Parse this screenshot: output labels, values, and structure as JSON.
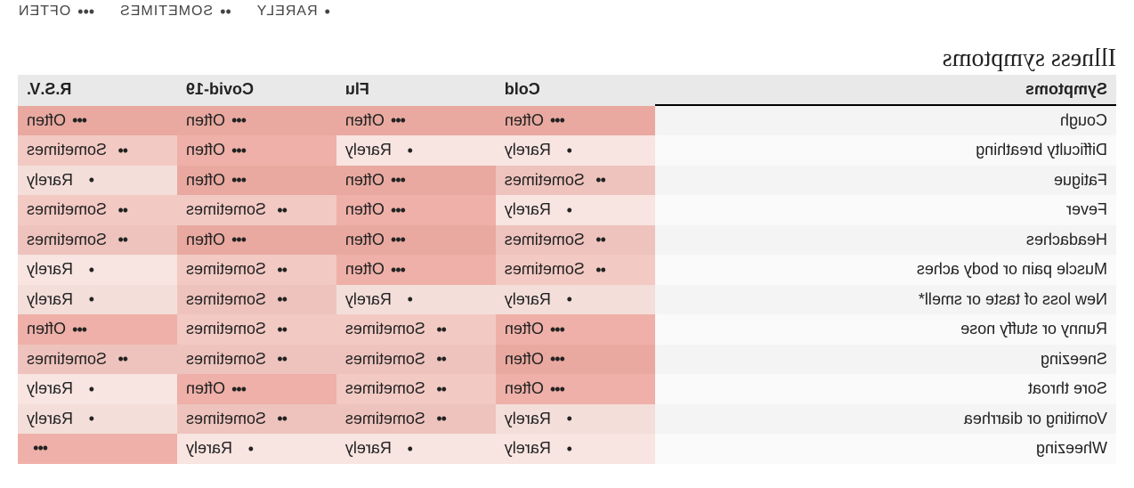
{
  "legend": {
    "rarely": {
      "dots": "•",
      "label": "RARELY"
    },
    "sometimes": {
      "dots": "••",
      "label": "SOMETIMES"
    },
    "often": {
      "dots": "•••",
      "label": "OFTEN"
    }
  },
  "title": "Illness symptoms",
  "columns": {
    "symptom": "Symptoms",
    "illnesses": [
      "Cold",
      "Flu",
      "Covid-19",
      "R.S.V."
    ]
  },
  "freq_map": {
    "Rarely": {
      "dots": "•",
      "css": "f-rarely"
    },
    "Sometimes": {
      "dots": "••",
      "css": "f-sometimes"
    },
    "Often": {
      "dots": "•••",
      "css": "f-often"
    },
    "": {
      "dots": "•••",
      "css": "f-unknown"
    }
  },
  "rows": [
    {
      "symptom": "Cough",
      "values": [
        "Often",
        "Often",
        "Often",
        "Often"
      ]
    },
    {
      "symptom": "Difficulty breathing",
      "values": [
        "Rarely",
        "Rarely",
        "Often",
        "Sometimes"
      ]
    },
    {
      "symptom": "Fatigue",
      "values": [
        "Sometimes",
        "Often",
        "Often",
        "Rarely"
      ]
    },
    {
      "symptom": "Fever",
      "values": [
        "Rarely",
        "Often",
        "Sometimes",
        "Sometimes"
      ]
    },
    {
      "symptom": "Headaches",
      "values": [
        "Sometimes",
        "Often",
        "Often",
        "Sometimes"
      ]
    },
    {
      "symptom": "Muscle pain or body aches",
      "values": [
        "Sometimes",
        "Often",
        "Sometimes",
        "Rarely"
      ]
    },
    {
      "symptom": "New loss of taste or smell*",
      "values": [
        "Rarely",
        "Rarely",
        "Sometimes",
        "Rarely"
      ]
    },
    {
      "symptom": "Runny or stuffy nose",
      "values": [
        "Often",
        "Sometimes",
        "Sometimes",
        "Often"
      ]
    },
    {
      "symptom": "Sneezing",
      "values": [
        "Often",
        "Sometimes",
        "Sometimes",
        "Sometimes"
      ]
    },
    {
      "symptom": "Sore throat",
      "values": [
        "Often",
        "Sometimes",
        "Often",
        "Rarely"
      ]
    },
    {
      "symptom": "Vomiting or diarrhea",
      "values": [
        "Rarely",
        "Sometimes",
        "Sometimes",
        "Rarely"
      ]
    },
    {
      "symptom": "Wheezing",
      "values": [
        "Rarely",
        "Rarely",
        "Rarely",
        ""
      ]
    }
  ],
  "chart_data": {
    "type": "heatmap",
    "title": "Illness symptoms",
    "x_categories": [
      "Cold",
      "Flu",
      "Covid-19",
      "R.S.V."
    ],
    "y_categories": [
      "Cough",
      "Difficulty breathing",
      "Fatigue",
      "Fever",
      "Headaches",
      "Muscle pain or body aches",
      "New loss of taste or smell*",
      "Runny or stuffy nose",
      "Sneezing",
      "Sore throat",
      "Vomiting or diarrhea",
      "Wheezing"
    ],
    "scale": {
      "Rarely": 1,
      "Sometimes": 2,
      "Often": 3,
      "": null
    },
    "values": [
      [
        3,
        3,
        3,
        3
      ],
      [
        1,
        1,
        3,
        2
      ],
      [
        2,
        3,
        3,
        1
      ],
      [
        1,
        3,
        2,
        2
      ],
      [
        2,
        3,
        3,
        2
      ],
      [
        2,
        3,
        2,
        1
      ],
      [
        1,
        1,
        2,
        1
      ],
      [
        3,
        2,
        2,
        3
      ],
      [
        3,
        2,
        2,
        2
      ],
      [
        3,
        2,
        3,
        1
      ],
      [
        1,
        2,
        2,
        1
      ],
      [
        1,
        1,
        1,
        null
      ]
    ],
    "legend": [
      "• RARELY",
      "•• SOMETIMES",
      "••• OFTEN"
    ],
    "note": "Image is rendered horizontally mirrored."
  }
}
